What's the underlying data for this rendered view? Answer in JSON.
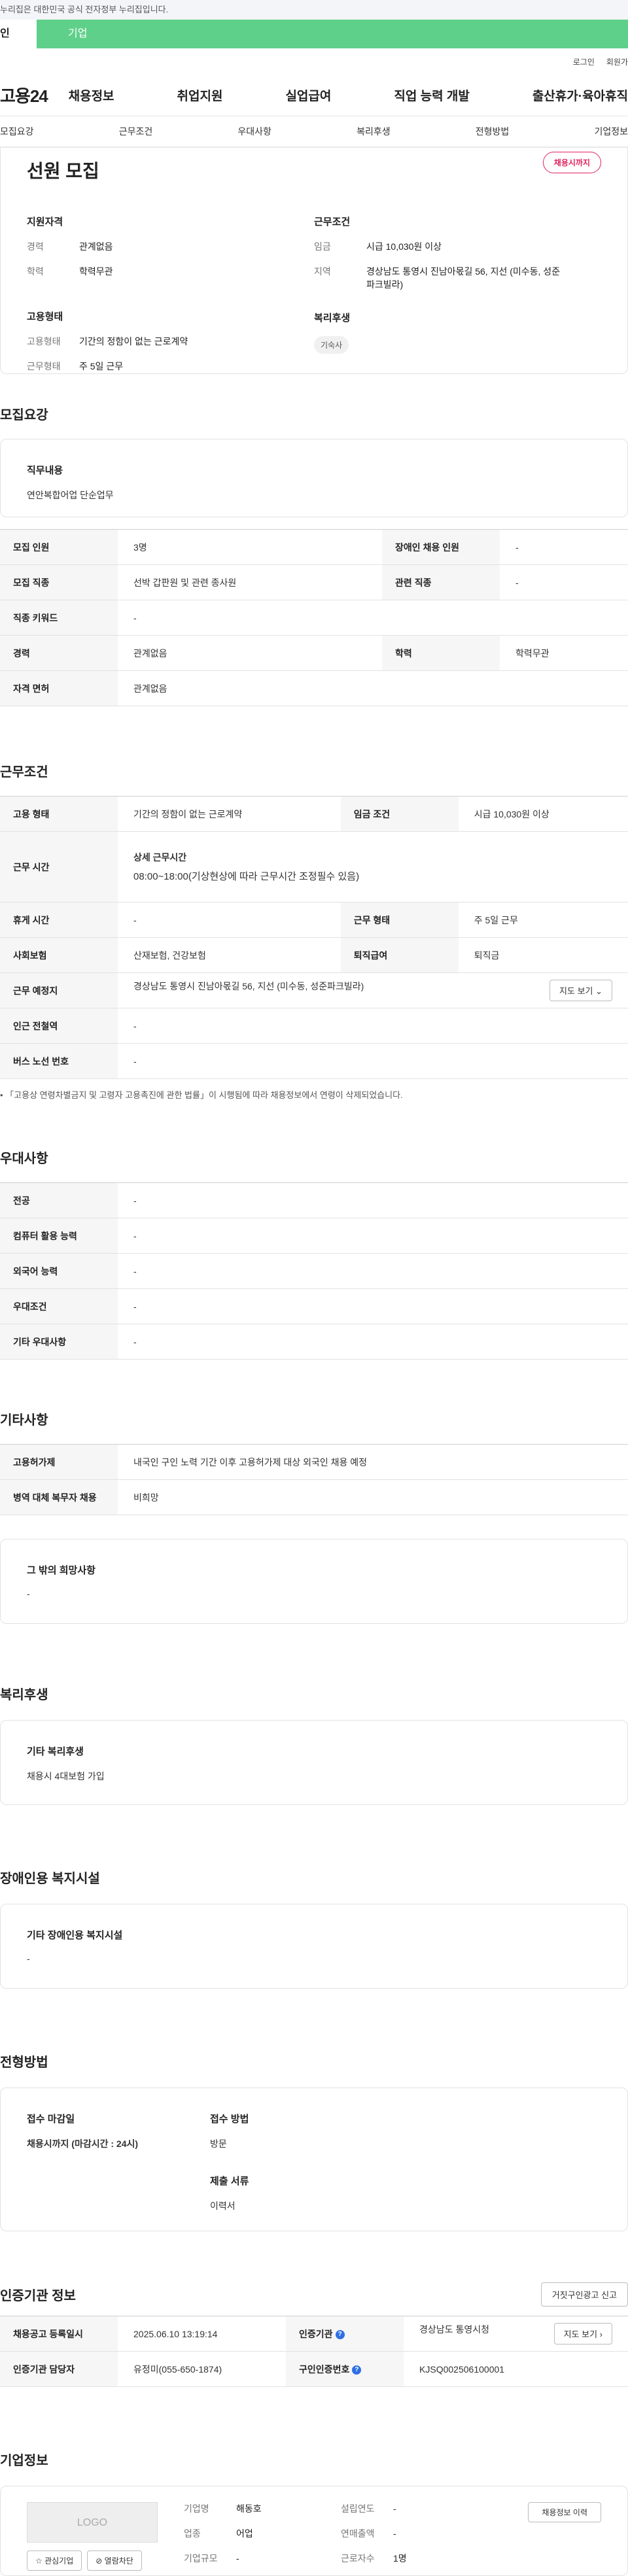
{
  "topbar": {
    "notice": "누리집은 대한민국 공식 전자정부 누리집입니다."
  },
  "user_tabs": {
    "personal": "인",
    "corporate": "기업"
  },
  "util": {
    "login": "로그인",
    "signup": "회원가"
  },
  "gnb": {
    "logo": "고용24",
    "items": [
      "채용정보",
      "취업지원",
      "실업급여",
      "직업 능력 개발",
      "출산휴가·육아휴직"
    ]
  },
  "subnav": [
    "모집요강",
    "근무조건",
    "우대사항",
    "복리후생",
    "전형방법",
    "기업정보"
  ],
  "job": {
    "title": "선원 모집",
    "badge": "채용시까지",
    "qual_title": "지원자격",
    "qual": [
      {
        "k": "경력",
        "v": "관계없음"
      },
      {
        "k": "학력",
        "v": "학력무관"
      }
    ],
    "cond_title": "근무조건",
    "cond": [
      {
        "k": "임금",
        "v": "시급 10,030원 이상"
      },
      {
        "k": "지역",
        "v": "경상남도 통영시 진남아몫길 56, 지선 (미수동, 성준파크빌라)"
      }
    ],
    "emp_title": "고용형태",
    "emp": [
      {
        "k": "고용형태",
        "v": "기간의 정함이 없는 근로계약"
      },
      {
        "k": "근무형태",
        "v": "주 5일 근무"
      }
    ],
    "welfare_title": "복리후생",
    "welfare_chip": "기숙사"
  },
  "recruit": {
    "title": "모집요강",
    "duty_label": "직무내용",
    "duty_value": "연안복합어업 단순업무",
    "rows": [
      {
        "k1": "모집 인원",
        "v1": "3명",
        "k2": "장애인 채용 인원",
        "v2": "-"
      },
      {
        "k1": "모집 직종",
        "v1": "선박 갑판원 및 관련 종사원",
        "k2": "관련 직종",
        "v2": "-"
      },
      {
        "k1": "직종 키워드",
        "v1": "-"
      },
      {
        "k1": "경력",
        "v1": "관계없음",
        "k2": "학력",
        "v2": "학력무관"
      },
      {
        "k1": "자격 면허",
        "v1": "관계없음"
      }
    ]
  },
  "work": {
    "title": "근무조건",
    "r1": {
      "k1": "고용 형태",
      "v1": "기간의 정함이 없는 근로계약",
      "k2": "임금 조건",
      "v2": "시급 10,030원 이상"
    },
    "time_label": "근무 시간",
    "time_head": "상세 근무시간",
    "time_value": "08:00~18:00(기상현상에 따라 근무시간 조정필수 있음)",
    "r3": {
      "k1": "휴게 시간",
      "v1": "-",
      "k2": "근무 형태",
      "v2": "주 5일 근무"
    },
    "r4": {
      "k1": "사회보험",
      "v1": "산재보험, 건강보험",
      "k2": "퇴직급여",
      "v2": "퇴직금"
    },
    "place_label": "근무 예정지",
    "place_value": "경상남도 통영시 진남아몫길 56, 지선 (미수동, 성준파크빌라)",
    "map_btn": "지도 보기 ⌄",
    "station_label": "인근 전철역",
    "station_value": "-",
    "bus_label": "버스 노선 번호",
    "bus_value": "-",
    "note": "• 「고용상 연령차별금지 및 고령자 고용촉진에 관한 법률」이 시행됨에 따라 채용정보에서 연령이 삭제되었습니다."
  },
  "pref": {
    "title": "우대사항",
    "rows": [
      {
        "k": "전공",
        "v": "-"
      },
      {
        "k": "컴퓨터 활용 능력",
        "v": "-"
      },
      {
        "k": "외국어 능력",
        "v": "-"
      },
      {
        "k": "우대조건",
        "v": "-"
      },
      {
        "k": "기타 우대사항",
        "v": "-"
      }
    ]
  },
  "etc": {
    "title": "기타사항",
    "rows": [
      {
        "k": "고용허가제",
        "v": "내국인 구인 노력 기간 이후 고용허가제 대상 외국인 채용 예정"
      },
      {
        "k": "병역 대체 복무자 채용",
        "v": "비희망"
      }
    ],
    "other_label": "그 밖의 희망사항",
    "other_value": "-"
  },
  "welfare": {
    "title": "복리후생",
    "label": "기타 복리후생",
    "value": "채용시 4대보험 가입"
  },
  "disability": {
    "title": "장애인용 복지시설",
    "label": "기타 장애인용 복지시설",
    "value": "-"
  },
  "selection": {
    "title": "전형방법",
    "deadline_label": "접수 마감일",
    "deadline_value": "채용시까지 (마감시간 : 24시)",
    "method_label": "접수 방법",
    "method_value": "방문",
    "docs_label": "제출 서류",
    "docs_value": "이력서"
  },
  "agency": {
    "title": "인증기관 정보",
    "report_btn": "거짓구인광고 신고",
    "r1": {
      "k1": "채용공고 등록일시",
      "v1": "2025.06.10 13:19:14",
      "k2": "인증기관",
      "v2": "경상남도 통영시청",
      "btn": "지도 보기 ›"
    },
    "r2": {
      "k1": "인증기관 담당자",
      "v1": "유정미(055-650-1874)",
      "k2": "구인인증번호",
      "v2": "KJSQ002506100001"
    }
  },
  "company": {
    "title": "기업정보",
    "logo": "LOGO",
    "fav_btn": "☆ 관심기업",
    "block_btn": "⊘ 열람차단",
    "history_btn": "채용정보 이력",
    "fields": [
      {
        "k": "기업명",
        "v": "해동호"
      },
      {
        "k": "업종",
        "v": "어업"
      },
      {
        "k": "기업규모",
        "v": "-"
      }
    ],
    "fields2": [
      {
        "k": "설립연도",
        "v": "-"
      },
      {
        "k": "연매출액",
        "v": "-"
      },
      {
        "k": "근로자수",
        "v": "1명"
      }
    ]
  },
  "colors": {
    "accent_green": "#5fd08a",
    "accent_red": "#e0245e",
    "info_blue": "#2f6fe4"
  }
}
